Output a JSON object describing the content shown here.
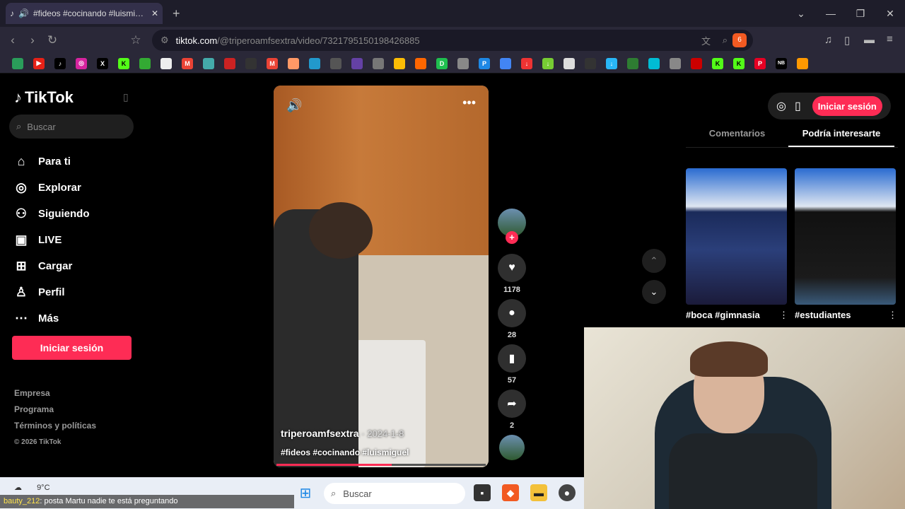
{
  "browser": {
    "tab_title": "#fideos #cocinando #luismiguel",
    "new_tab": "+",
    "url_host": "tiktok.com",
    "url_path": "/@triperoamfsextra/video/7321795150198426885",
    "brave_badge": "6"
  },
  "sidebar": {
    "logo": "TikTok",
    "search_placeholder": "Buscar",
    "items": [
      {
        "icon": "home-icon",
        "label": "Para ti"
      },
      {
        "icon": "compass-icon",
        "label": "Explorar"
      },
      {
        "icon": "following-icon",
        "label": "Siguiendo"
      },
      {
        "icon": "live-icon",
        "label": "LIVE"
      },
      {
        "icon": "upload-icon",
        "label": "Cargar"
      },
      {
        "icon": "profile-icon",
        "label": "Perfil"
      },
      {
        "icon": "more-icon",
        "label": "Más"
      }
    ],
    "login": "Iniciar sesión",
    "footer": [
      "Empresa",
      "Programa",
      "Términos y políticas"
    ],
    "copyright": "© 2026 TikTok"
  },
  "video": {
    "author": "triperoamfsextra",
    "date": "· 2024-1-8",
    "tags": "#fideos #cocinando #luismiguel",
    "progress": 0.55,
    "likes": "1178",
    "comments": "28",
    "saves": "57",
    "shares": "2"
  },
  "right": {
    "login": "Iniciar sesión",
    "tabs": [
      "Comentarios",
      "Podría interesarte"
    ],
    "cards": [
      {
        "caption": "#boca #gimnasia"
      },
      {
        "caption": "#estudiantes"
      }
    ]
  },
  "taskbar": {
    "temp": "9°C",
    "search": "Buscar"
  },
  "chat": {
    "user": "bauty_212",
    "message": ": posta Martu nadie te está preguntando"
  },
  "colors": {
    "accent": "#fe2c55"
  }
}
